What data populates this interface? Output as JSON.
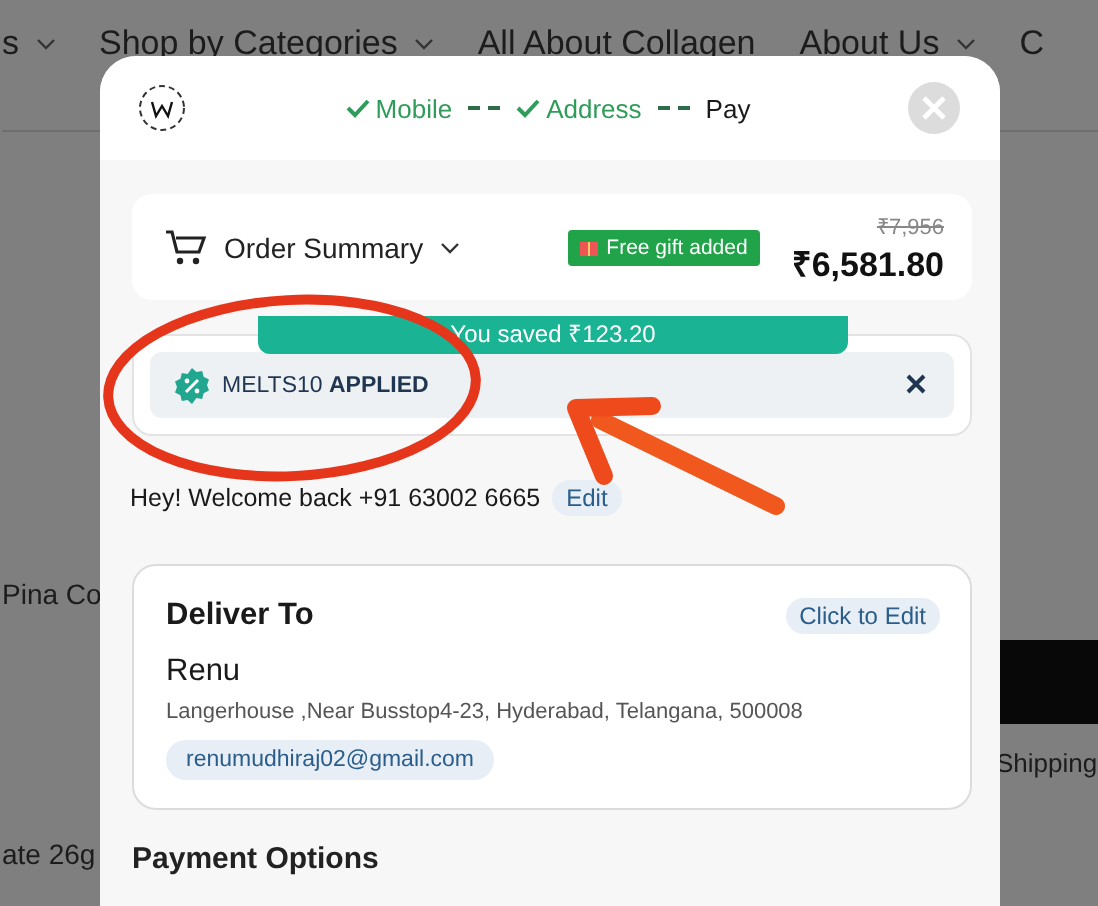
{
  "background_page": {
    "nav": [
      {
        "label": "s",
        "dropdown": true
      },
      {
        "label": "Shop by Categories",
        "dropdown": true
      },
      {
        "label": "All About Collagen",
        "dropdown": false
      },
      {
        "label": "About Us",
        "dropdown": true
      },
      {
        "label": "C",
        "dropdown": false
      }
    ],
    "left_texts": [
      "Pina Co",
      "ate 26g"
    ],
    "right_text": "Shipping"
  },
  "checkout": {
    "steps": [
      {
        "label": "Mobile",
        "completed": true
      },
      {
        "label": "Address",
        "completed": true
      },
      {
        "label": "Pay",
        "completed": false
      }
    ],
    "order_summary": {
      "label": "Order Summary",
      "gift_badge": "Free gift added",
      "original_price": "₹7,956",
      "price": "₹6,581.80"
    },
    "coupon": {
      "savings_banner": "You saved ₹123.20",
      "status": "MELTS10 **APPLIED**"
    },
    "welcome": {
      "text": "Hey! Welcome back +91 63002 6665",
      "edit_link": "Edit"
    },
    "delivery": {
      "title": "Deliver To",
      "edit_button": "Click to Edit",
      "name": "Renu",
      "address": "Langerhouse ,Near Busstop4-23, Hyderabad, Telangana, 500008",
      "email": "renumudhiraj02@gmail.com"
    },
    "payment_title": "Payment Options"
  }
}
